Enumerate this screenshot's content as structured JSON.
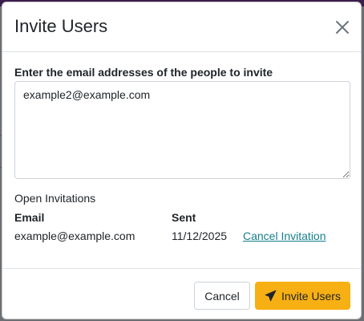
{
  "modal": {
    "title": "Invite Users",
    "email_label": "Enter the email addresses of the people to invite",
    "email_value": "example2@example.com",
    "open_invitations_title": "Open Invitations",
    "table": {
      "headers": [
        "Email",
        "Sent"
      ],
      "rows": [
        {
          "email": "example@example.com",
          "sent": "11/12/2025",
          "action": "Cancel Invitation"
        }
      ]
    },
    "buttons": {
      "cancel": "Cancel",
      "invite": "Invite Users"
    }
  },
  "colors": {
    "primary_button": "#f7b014",
    "link": "#16808d"
  },
  "icons": {
    "close": "close-icon",
    "invite": "paper-plane-icon"
  }
}
